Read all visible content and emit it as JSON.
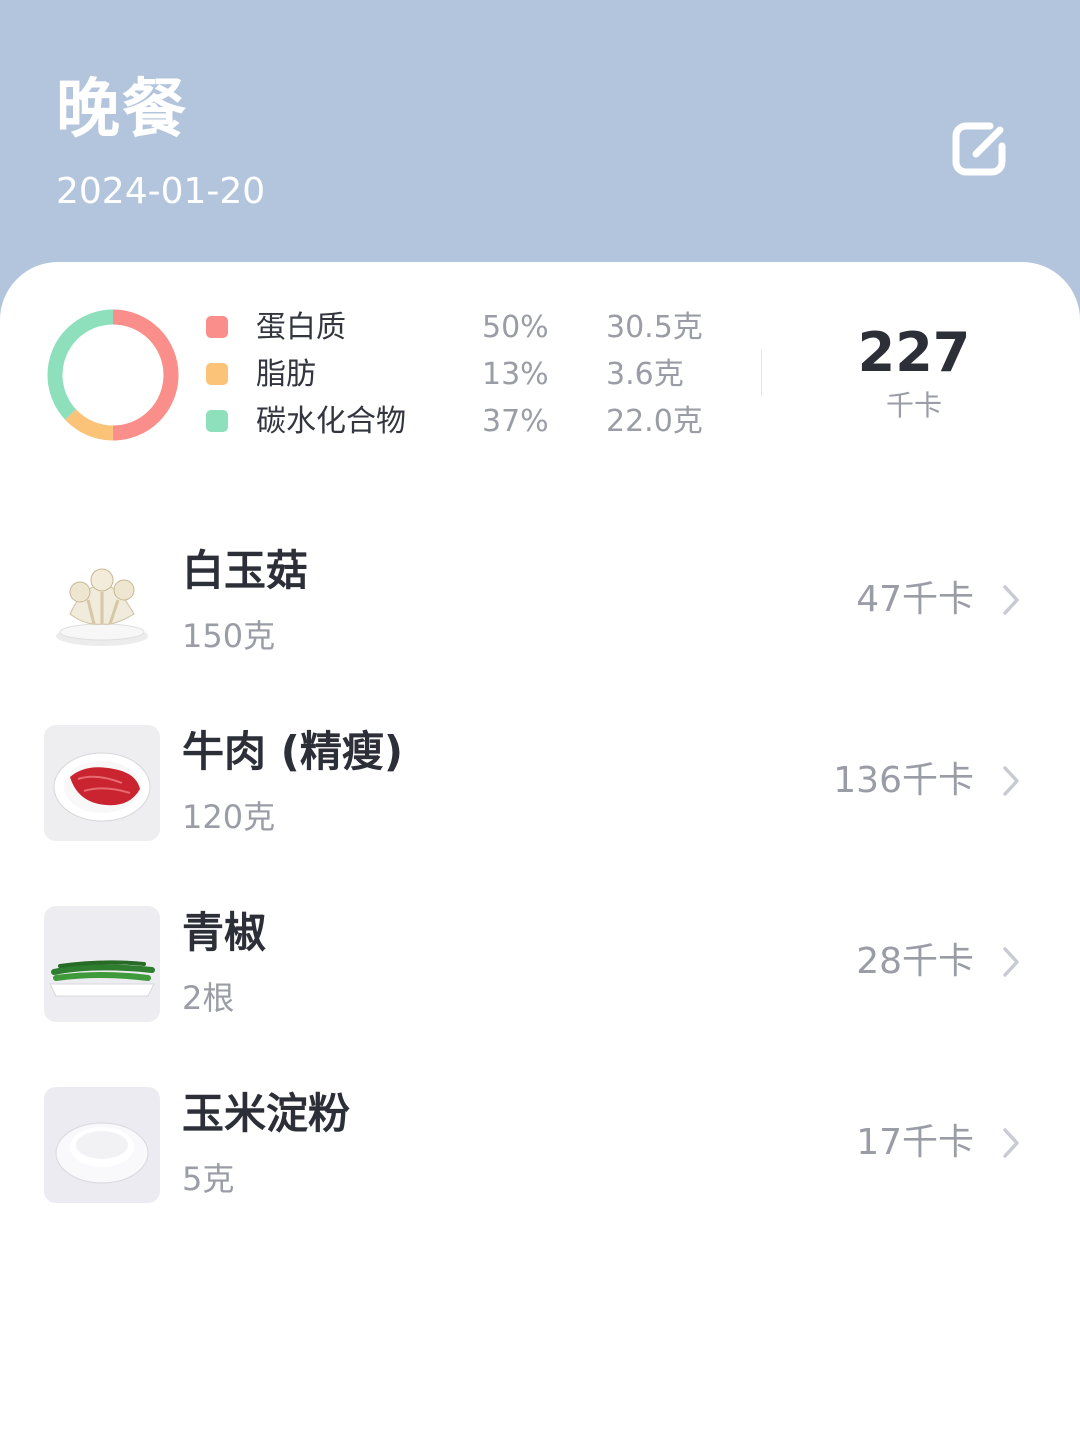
{
  "header": {
    "title": "晚餐",
    "date": "2024-01-20",
    "edit_icon": "edit-icon"
  },
  "summary": {
    "macros": [
      {
        "name": "蛋白质",
        "percent": "50%",
        "grams": "30.5克",
        "color": "#f98e8a",
        "fraction": 0.5
      },
      {
        "name": "脂肪",
        "percent": "13%",
        "grams": "3.6克",
        "color": "#fbc377",
        "fraction": 0.13
      },
      {
        "name": "碳水化合物",
        "percent": "37%",
        "grams": "22.0克",
        "color": "#8ee0bd",
        "fraction": 0.37
      }
    ],
    "total_kcal": "227",
    "total_unit": "千卡"
  },
  "foods": [
    {
      "name": "白玉菇",
      "amount": "150克",
      "kcal": "47千卡"
    },
    {
      "name": "牛肉 (精瘦)",
      "amount": "120克",
      "kcal": "136千卡"
    },
    {
      "name": "青椒",
      "amount": "2根",
      "kcal": "28千卡"
    },
    {
      "name": "玉米淀粉",
      "amount": "5克",
      "kcal": "17千卡"
    }
  ]
}
